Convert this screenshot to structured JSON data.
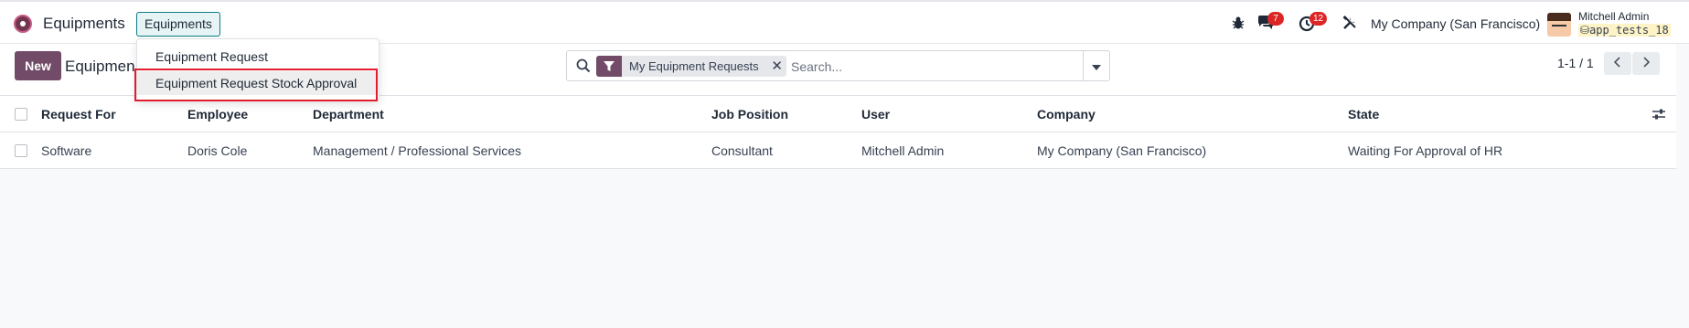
{
  "navbar": {
    "app_name": "Equipments",
    "menu_button": "Equipments",
    "messages_count": "7",
    "activities_count": "12",
    "company": "My Company (San Francisco)",
    "user_name": "Mitchell Admin",
    "database": "app_tests_18"
  },
  "dropdown": {
    "items": [
      {
        "label": "Equipment Request"
      },
      {
        "label": "Equipment Request Stock Approval"
      }
    ]
  },
  "control_panel": {
    "new_label": "New",
    "breadcrumb": "Equipmen",
    "facet_label": "My Equipment Requests",
    "search_placeholder": "Search...",
    "pager": "1-1 / 1"
  },
  "table": {
    "columns": [
      "Request For",
      "Employee",
      "Department",
      "Job Position",
      "User",
      "Company",
      "State"
    ],
    "rows": [
      {
        "request_for": "Software",
        "employee": "Doris Cole",
        "department": "Management / Professional Services",
        "job_position": "Consultant",
        "user": "Mitchell Admin",
        "company": "My Company (San Francisco)",
        "state": "Waiting For Approval of HR"
      }
    ]
  },
  "colors": {
    "brand": "#714b67",
    "accent": "#0c7e86",
    "highlight": "#e11d2f",
    "badge": "#dc2626"
  }
}
